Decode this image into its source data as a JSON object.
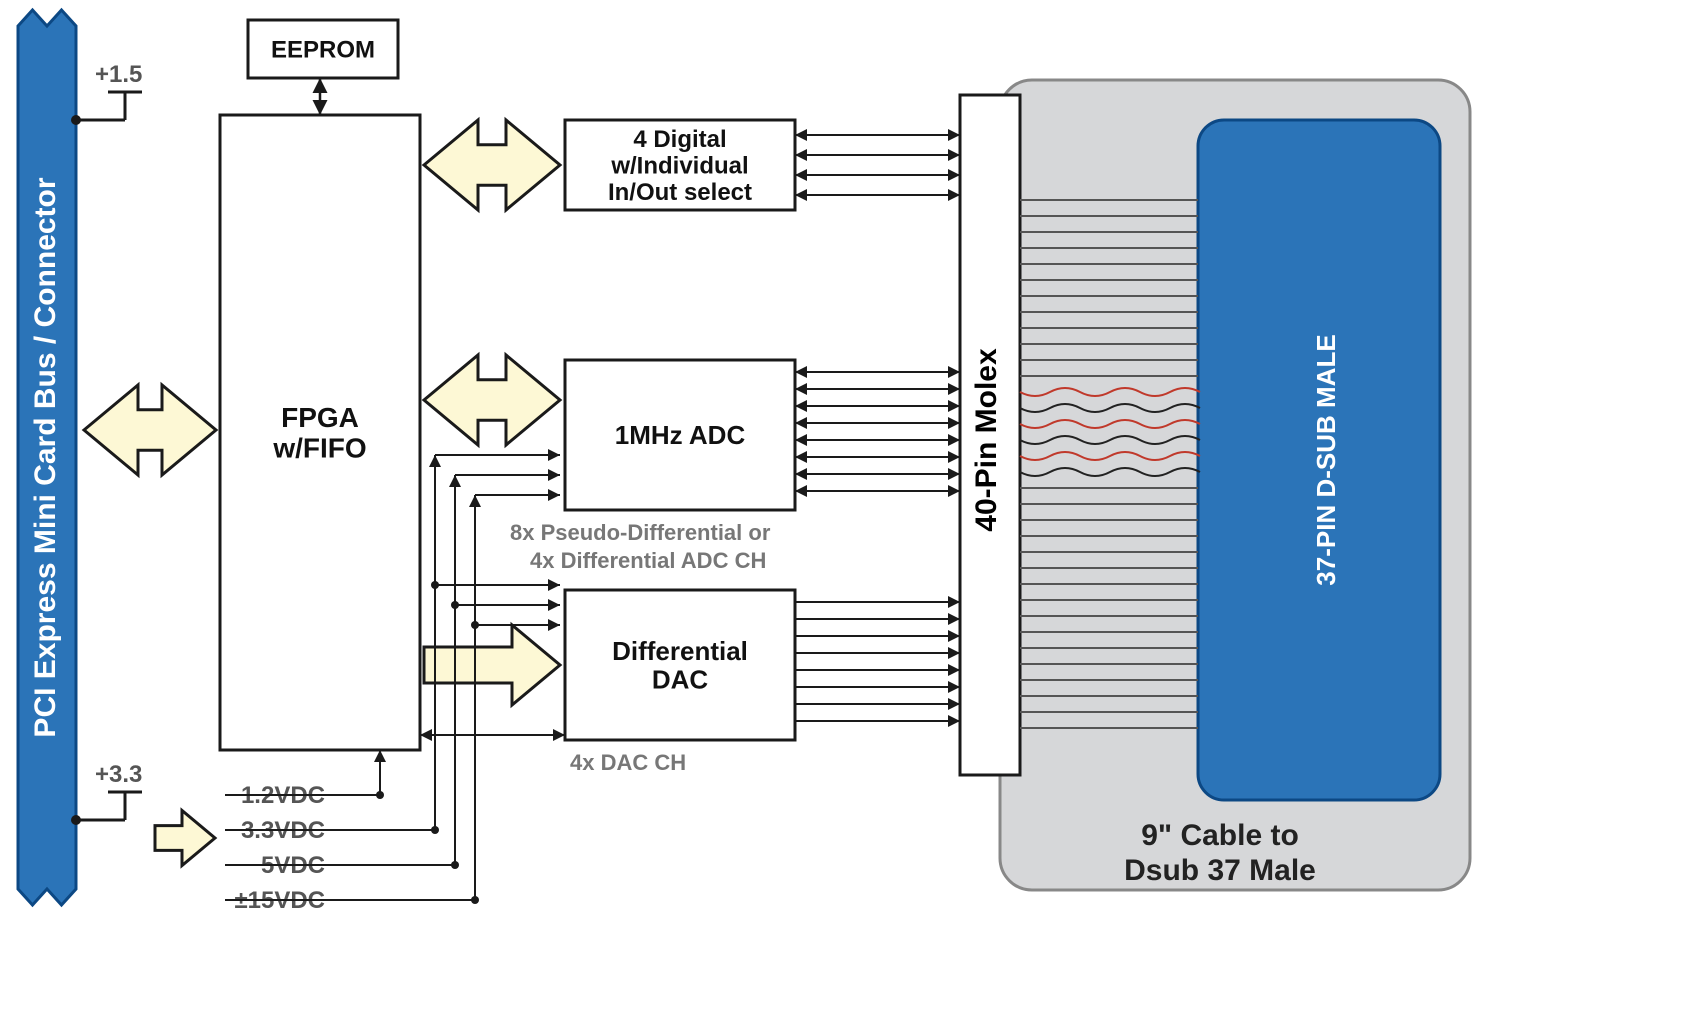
{
  "left_bus": {
    "label": "PCI Express Mini Card Bus / Connector",
    "v1": "+1.5",
    "v2": "+3.3"
  },
  "blocks": {
    "eeprom": "EEPROM",
    "fpga_l1": "FPGA",
    "fpga_l2": "w/FIFO",
    "digital_l1": "4 Digital",
    "digital_l2": "w/Individual",
    "digital_l3": "In/Out select",
    "adc": "1MHz ADC",
    "adc_note_l1": "8x Pseudo-Differential or",
    "adc_note_l2": "4x Differential ADC CH",
    "dac_l1": "Differential",
    "dac_l2": "DAC",
    "dac_note": "4x DAC CH",
    "molex": "40-Pin Molex",
    "dsub": "37-PIN D-SUB MALE",
    "cable_l1": "9\" Cable to",
    "cable_l2": "Dsub 37 Male"
  },
  "rails": {
    "r1": "1.2VDC",
    "r2": "3.3VDC",
    "r3": "5VDC",
    "r4": "±15VDC"
  },
  "colors": {
    "bus": "#2b74b8",
    "bus_stroke": "#0c4884",
    "arrow": "#fdf8d5",
    "arrow_stroke": "#1a1a1a",
    "block_stroke": "#1a1a1a",
    "text_gray": "#777",
    "cable": "#d6d7d9",
    "dsub": "#2b74b8"
  }
}
